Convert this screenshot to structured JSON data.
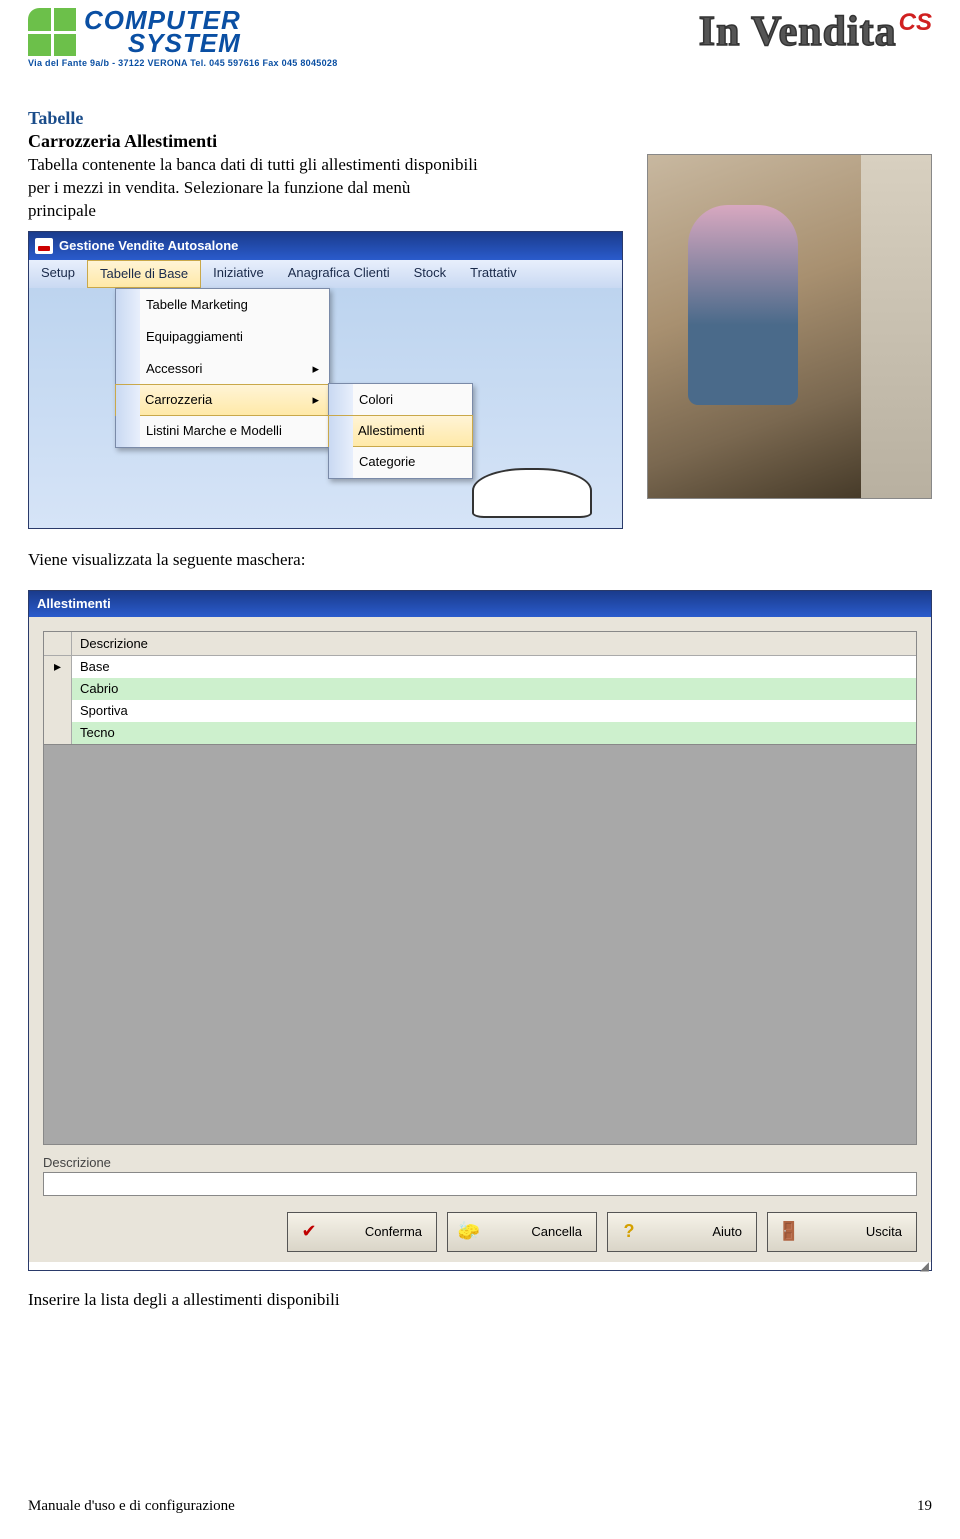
{
  "header": {
    "company_line1": "COMPUTER",
    "company_line2": "SYSTEM",
    "address": "Via del Fante 9a/b - 37122 VERONA   Tel. 045 597616   Fax 045 8045028",
    "product_name": "In Vendita",
    "product_badge": "CS"
  },
  "section": {
    "heading": "Tabelle",
    "subheading": "Carrozzeria Allestimenti",
    "para1": "Tabella contenente la banca dati di tutti gli allestimenti disponibili per i mezzi in vendita. Selezionare la funzione dal menù principale",
    "para2": "Viene visualizzata la seguente maschera:",
    "para3": "Inserire la lista degli a allestimenti disponibili"
  },
  "menu_window": {
    "title": "Gestione Vendite Autosalone",
    "menu_items": [
      "Setup",
      "Tabelle di Base",
      "Iniziative",
      "Anagrafica Clienti",
      "Stock",
      "Trattativ"
    ],
    "active_index": 1,
    "dropdown": [
      {
        "label": "Tabelle Marketing",
        "submenu": false
      },
      {
        "label": "Equipaggiamenti",
        "submenu": false
      },
      {
        "label": "Accessori",
        "submenu": true
      },
      {
        "label": "Carrozzeria",
        "submenu": true,
        "hover": true
      },
      {
        "label": "Listini Marche e  Modelli",
        "submenu": false
      }
    ],
    "sub_dropdown": [
      {
        "label": "Colori"
      },
      {
        "label": "Allestimenti",
        "hover": true
      },
      {
        "label": "Categorie"
      }
    ]
  },
  "grid_window": {
    "title": "Allestimenti",
    "column": "Descrizione",
    "rows": [
      "Base",
      "Cabrio",
      "Sportiva",
      "Tecno"
    ],
    "field_label": "Descrizione",
    "buttons": [
      {
        "label": "Conferma",
        "icon": "✔",
        "color": "#c00000"
      },
      {
        "label": "Cancella",
        "icon": "✎",
        "color": "#333"
      },
      {
        "label": "Aiuto",
        "icon": "?",
        "color": "#d4a000"
      },
      {
        "label": "Uscita",
        "icon": "⎋",
        "color": "#1a5aa8"
      }
    ]
  },
  "footer": {
    "left": "Manuale d'uso e di configurazione",
    "right": "19"
  }
}
